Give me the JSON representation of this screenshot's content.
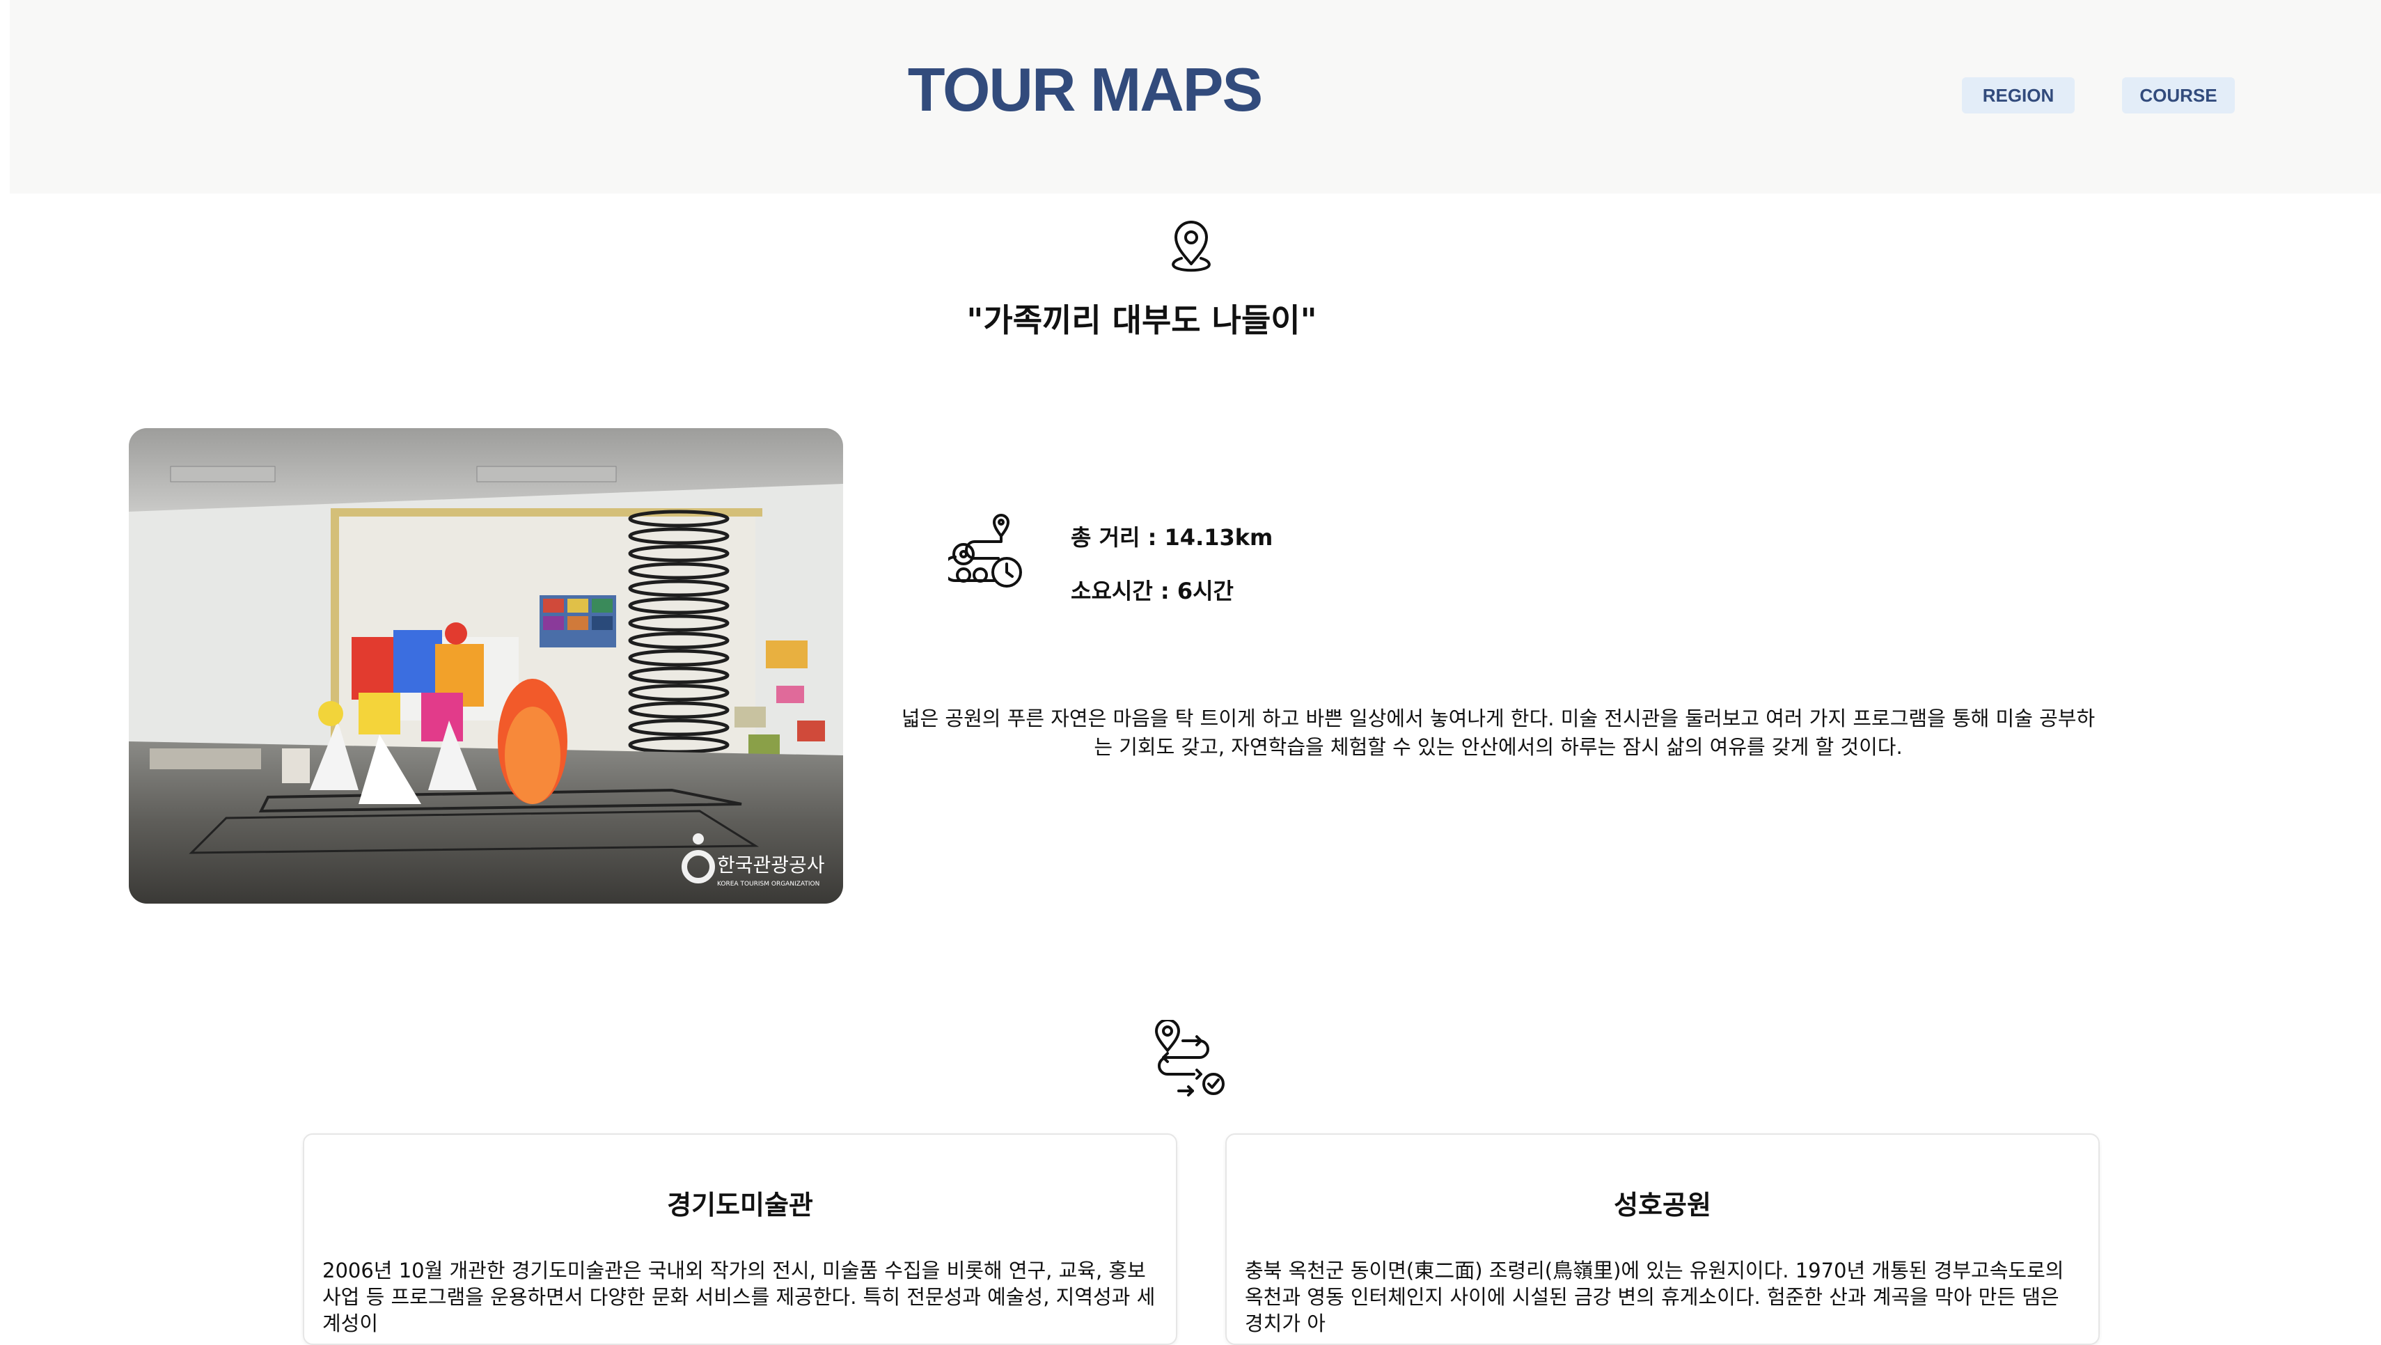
{
  "header": {
    "logo": "TOUR MAPS",
    "nav": [
      {
        "label": "REGION"
      },
      {
        "label": "COURSE"
      }
    ]
  },
  "icons": {
    "location": "map-pin-icon",
    "route": "route-clock-icon",
    "course": "course-path-icon"
  },
  "title": "\"가족끼리 대부도 나들이\"",
  "photo": {
    "alt": "경기도미술관 전시실",
    "watermark": "한국관광공사",
    "watermark_sub": "KOREA TOURISM ORGANIZATION"
  },
  "stats": {
    "distance": "총 거리 : 14.13km",
    "time": "소요시간 : 6시간"
  },
  "description": "넓은 공원의 푸른 자연은 마음을 탁 트이게 하고 바쁜 일상에서 놓여나게 한다. 미술 전시관을 둘러보고 여러 가지 프로그램을 통해 미술 공부하는 기회도 갖고, 자연학습을 체험할 수 있는 안산에서의 하루는 잠시 삶의 여유를 갖게 할 것이다.",
  "cards": [
    {
      "title": "경기도미술관",
      "text": "2006년 10월 개관한 경기도미술관은 국내외 작가의 전시, 미술품 수집을 비롯해 연구, 교육, 홍보사업 등 프로그램을 운용하면서 다양한 문화 서비스를 제공한다. 특히 전문성과 예술성, 지역성과 세계성이"
    },
    {
      "title": "성호공원",
      "text": "충북 옥천군 동이면(東二面) 조령리(鳥嶺里)에 있는 유원지이다. 1970년 개통된 경부고속도로의 옥천과 영동 인터체인지 사이에 시설된 금강 변의 휴게소이다. 험준한 산과 계곡을 막아 만든 댐은 경치가 아"
    }
  ],
  "colors": {
    "brand": "#324b7c",
    "nav_bg": "#e3edf8",
    "header_bg": "#f8f8f7"
  }
}
